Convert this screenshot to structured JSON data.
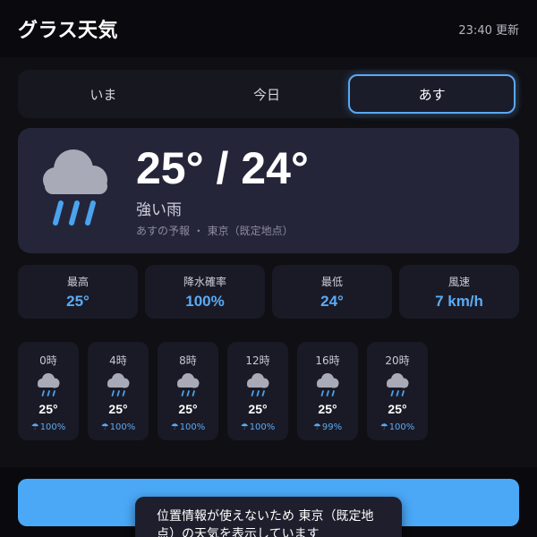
{
  "header": {
    "title": "グラス天気",
    "updated": "23:40 更新"
  },
  "tabs": [
    {
      "label": "いま",
      "active": false
    },
    {
      "label": "今日",
      "active": false
    },
    {
      "label": "あす",
      "active": true
    }
  ],
  "hero": {
    "icon": "rain-cloud-icon",
    "temp_range": "25° / 24°",
    "condition": "強い雨",
    "note": "あすの予報 ・ 東京（既定地点）"
  },
  "stats": [
    {
      "label": "最高",
      "value": "25°"
    },
    {
      "label": "降水確率",
      "value": "100%"
    },
    {
      "label": "最低",
      "value": "24°"
    },
    {
      "label": "風速",
      "value": "7 km/h"
    }
  ],
  "hourly": [
    {
      "time": "0時",
      "temp": "25°",
      "precip": "100%"
    },
    {
      "time": "4時",
      "temp": "25°",
      "precip": "100%"
    },
    {
      "time": "8時",
      "temp": "25°",
      "precip": "100%"
    },
    {
      "time": "12時",
      "temp": "25°",
      "precip": "100%"
    },
    {
      "time": "16時",
      "temp": "25°",
      "precip": "99%"
    },
    {
      "time": "20時",
      "temp": "25°",
      "precip": "100%"
    }
  ],
  "toast": {
    "message": "位置情報が使えないため 東京（既定地点）の天気を表示しています"
  },
  "colors": {
    "accent": "#5aabf5",
    "button": "#4ba8f7",
    "cloud": "#a9aab8",
    "rain": "#4aa3f0"
  }
}
